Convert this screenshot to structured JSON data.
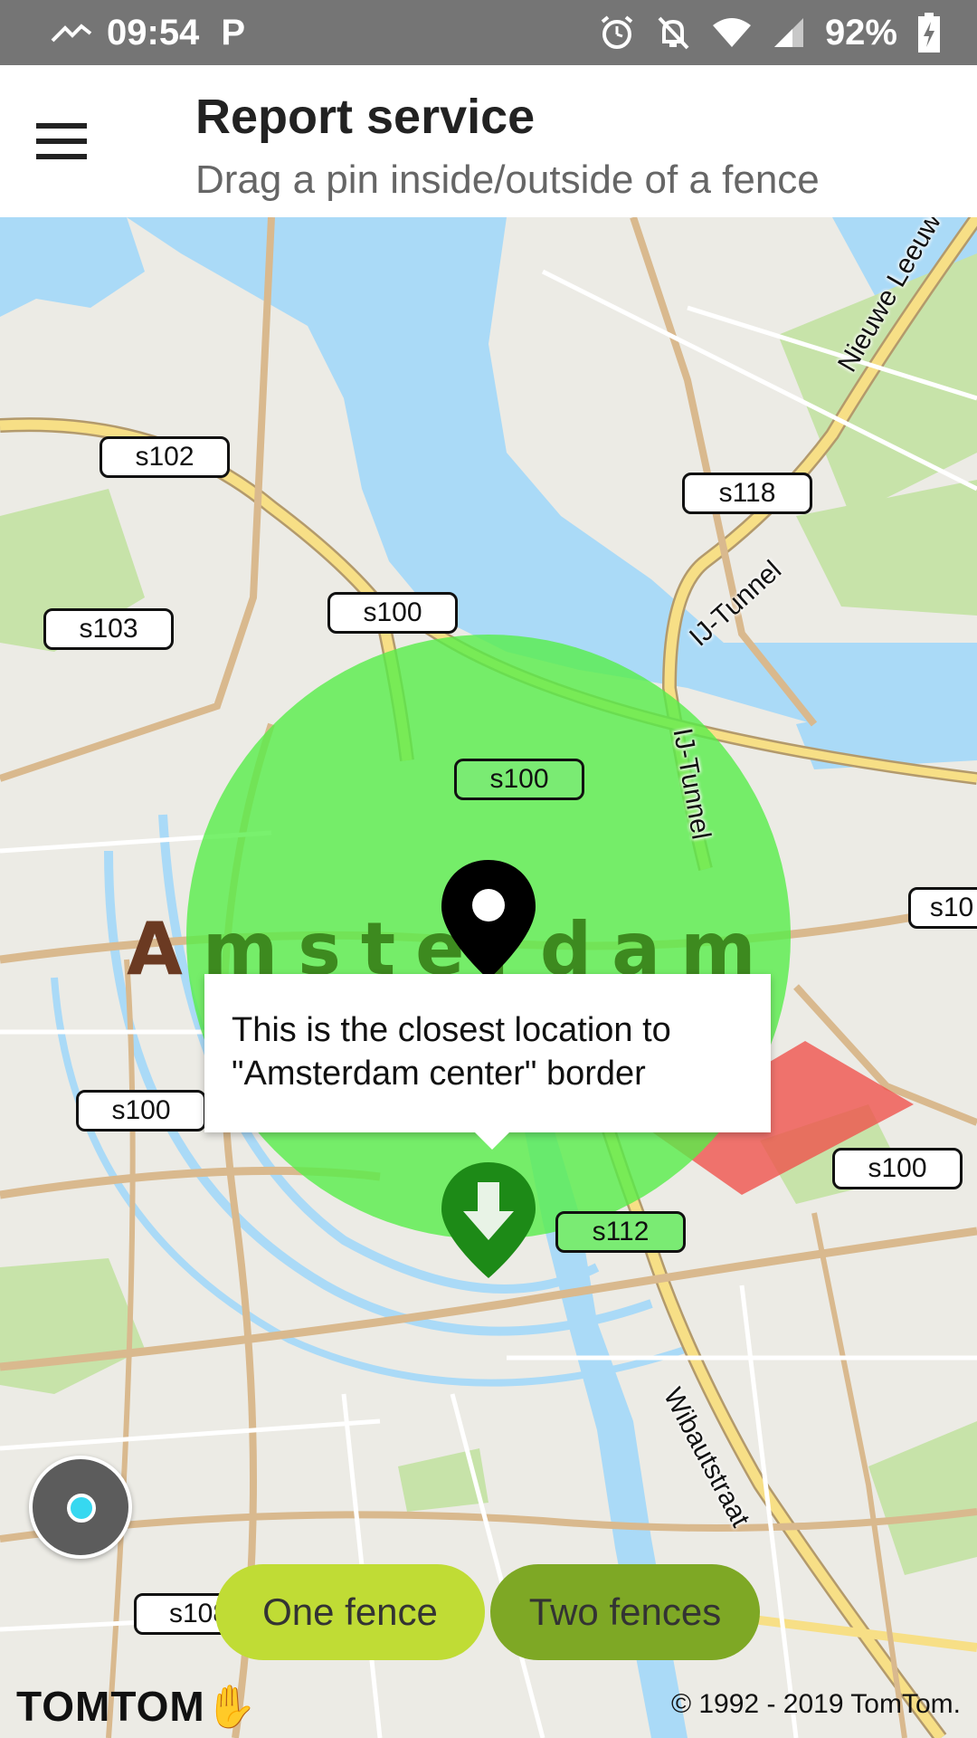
{
  "status_bar": {
    "time": "09:54",
    "p_glyph": "P",
    "battery": "92%",
    "icons": [
      "signal-wave-icon",
      "parking-icon",
      "alarm-icon",
      "notifications-off-icon",
      "wifi-icon",
      "cell-signal-icon",
      "battery-charging-icon"
    ]
  },
  "header": {
    "title": "Report service",
    "subtitle": "Drag a pin inside/outside of a fence"
  },
  "map": {
    "road_labels": [
      "s102",
      "s118",
      "s100",
      "s103",
      "s100",
      "s100",
      "s10",
      "s100",
      "s100",
      "s112",
      "s108"
    ],
    "city_label_a": "A",
    "city_label_rest": "msterdam",
    "street_names": [
      "Nieuwe Leeuw",
      "IJ-Tunnel",
      "IJ-Tunnel",
      "Wibautstraat"
    ],
    "colors": {
      "water": "#aadaf7",
      "land": "#ecebe5",
      "park": "#c7e3a9",
      "major_road": "#f7df86",
      "road": "#d9b98e",
      "fence_green": "#58ee4a",
      "fence_red": "#f0504a"
    }
  },
  "tooltip": {
    "text": "This is the closest location to \"Amsterdam center\" border"
  },
  "buttons": {
    "one_fence": "One fence",
    "two_fences": "Two fences"
  },
  "footer": {
    "logo": "TOMTOM",
    "copyright": "© 1992 - 2019 TomTom."
  }
}
